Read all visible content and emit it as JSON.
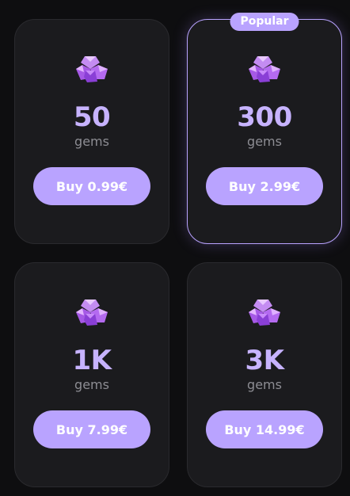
{
  "packs": [
    {
      "amount": "50",
      "unit": "gems",
      "buy_label": "Buy 0.99€"
    },
    {
      "amount": "300",
      "unit": "gems",
      "buy_label": "Buy 2.99€",
      "badge": "Popular"
    },
    {
      "amount": "1K",
      "unit": "gems",
      "buy_label": "Buy 7.99€"
    },
    {
      "amount": "3K",
      "unit": "gems",
      "buy_label": "Buy 14.99€"
    }
  ],
  "icons": {
    "gem": "gem-icon"
  },
  "colors": {
    "accent": "#b9a3ff",
    "amount_text": "#c7b3ff",
    "card_bg": "#1b1b1e",
    "page_bg": "#0e0e10"
  }
}
